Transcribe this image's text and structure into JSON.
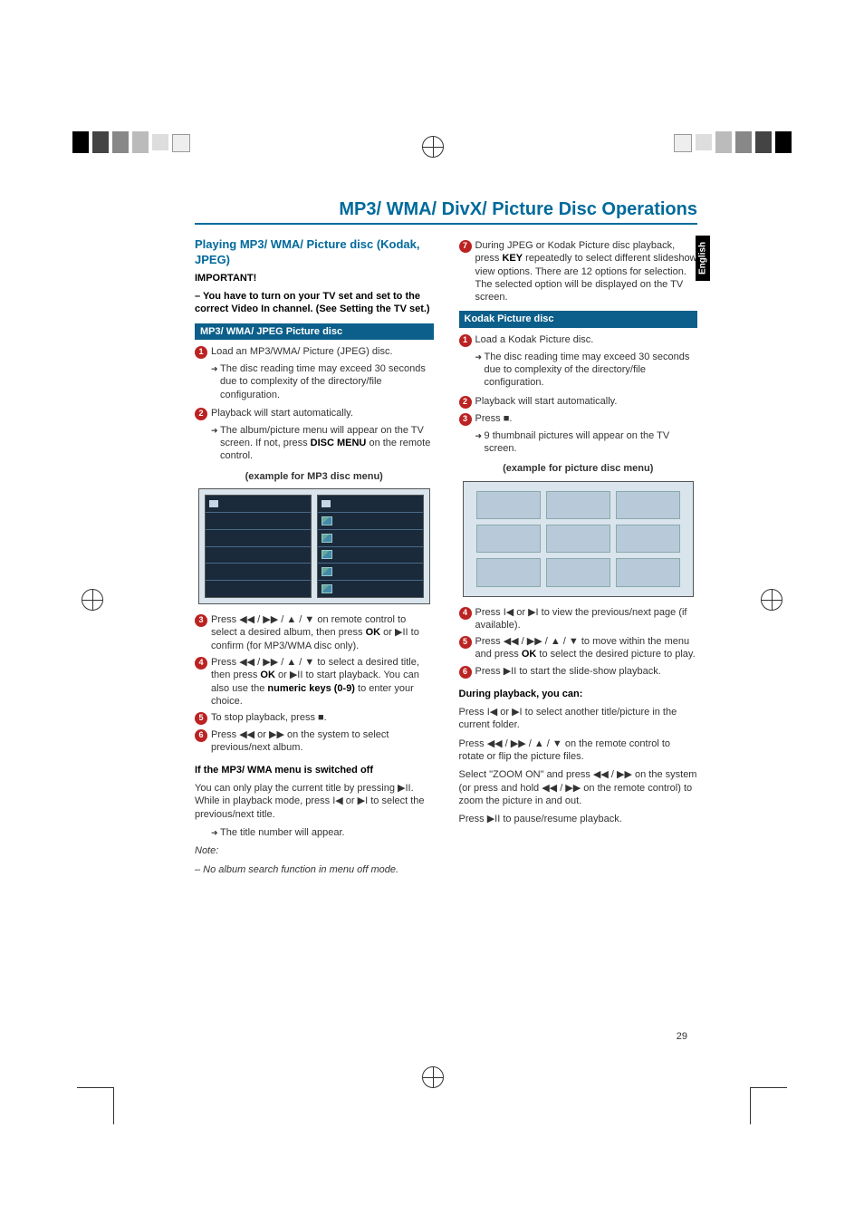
{
  "title": "MP3/ WMA/ DivX/ Picture Disc Operations",
  "sideTab": "English",
  "pageNumber": "29",
  "left": {
    "heading": "Playing MP3/ WMA/ Picture disc (Kodak, JPEG)",
    "importantLabel": "IMPORTANT!",
    "importantBody": "– You have to turn on your TV set and set to the correct Video In channel. (See Setting the TV set.)",
    "bar1": "MP3/ WMA/ JPEG Picture disc",
    "step1": "Load an MP3/WMA/ Picture (JPEG) disc.",
    "step1result": "The disc reading time may exceed 30 seconds due to complexity of the directory/file configuration.",
    "step2": "Playback will start automatically.",
    "step2result": "The album/picture menu will appear on the TV screen. If not, press ",
    "step2resultB": "DISC MENU",
    "step2resultC": " on the remote control.",
    "exampleLabel": "(example for MP3 disc menu)",
    "step3a": "Press ",
    "step3b": " on remote control to select a desired album, then press ",
    "step3ok": "OK",
    "step3c": " or ",
    "step3d": " to confirm (for MP3/WMA disc only).",
    "step4a": "Press ",
    "step4b": " to select a desired title, then press ",
    "step4ok": "OK",
    "step4c": " or ",
    "step4d": " to start playback. You can also use the ",
    "step4keys": "numeric keys (0-9)",
    "step4e": " to enter your choice.",
    "step5a": "To stop playback, press ",
    "step5b": ".",
    "step6a": "Press ",
    "step6b": " on the system to select previous/next album.",
    "offHeading": "If the MP3/ WMA menu is switched off",
    "offBody1a": "You can only play the current title by pressing ",
    "offBody1b": ".  While in playback mode, press ",
    "offBody1c": " to select the previous/next title.",
    "offResult": "The title number will appear.",
    "noteLabel": "Note:",
    "noteBody": "– No album search function in menu off mode."
  },
  "right": {
    "step7a": "During JPEG or Kodak Picture disc playback, press ",
    "step7key": "KEY",
    "step7b": " repeatedly to select different slideshow view options. There are 12 options for selection. The selected option will be displayed on the TV screen.",
    "bar2": "Kodak Picture disc",
    "k1": "Load a Kodak Picture disc.",
    "k1result": "The disc reading time may exceed 30 seconds due to complexity of the directory/file configuration.",
    "k2": "Playback will start automatically.",
    "k3a": "Press ",
    "k3b": ".",
    "k3result": "9 thumbnail pictures will appear on the TV screen.",
    "exampleLabel": "(example for picture disc menu)",
    "k4a": "Press ",
    "k4b": " to view the previous/next page (if available).",
    "k5a": "Press ",
    "k5b": " to move within the menu and press ",
    "k5ok": "OK",
    "k5c": " to select the desired picture to play.",
    "k6a": "Press ",
    "k6b": " to start the slide-show playback.",
    "duringHeading": "During playback, you can:",
    "d1a": "Press ",
    "d1b": " to select another title/picture in the current folder.",
    "d2a": "Press ",
    "d2b": " on the remote control to rotate or flip the picture files.",
    "d3a": "Select \"ZOOM ON\" and press ",
    "d3b": " on the system (or press and hold ",
    "d3c": " on the remote control) to zoom the picture in and out.",
    "d4a": "Press ",
    "d4b": " to pause/resume playback."
  },
  "glyphs": {
    "rewff": "◀◀ / ▶▶ / ▲ / ▼",
    "rewffOnly": "◀◀ / ▶▶",
    "rewffOr": "◀◀ or ▶▶",
    "playpause": "▶II",
    "stop": "■",
    "prevnext": "I◀ or ▶I",
    "prevnextOr": "I◀  or  ▶I"
  }
}
